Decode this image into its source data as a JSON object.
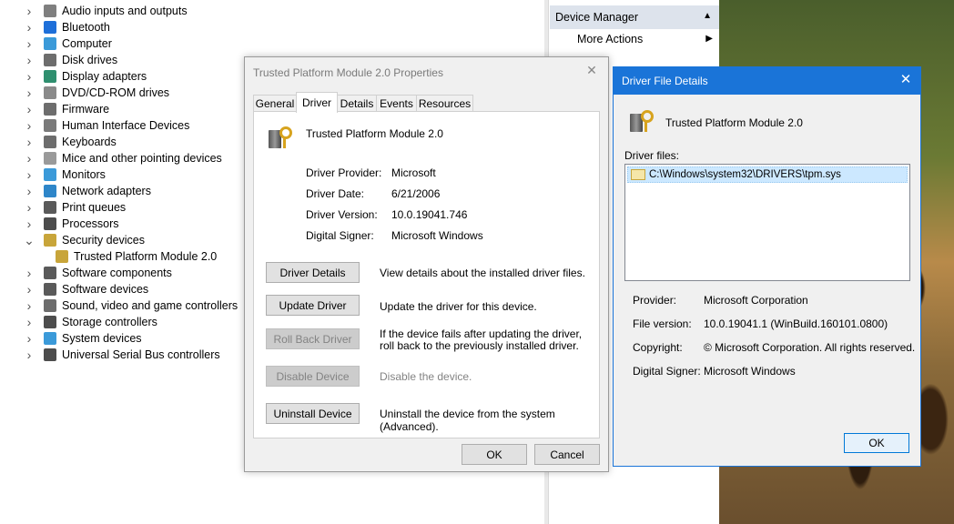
{
  "device_tree": {
    "items": [
      {
        "label": "Audio inputs and outputs",
        "icon": "speaker-icon",
        "color": "#7f7f7f",
        "expanded": false
      },
      {
        "label": "Bluetooth",
        "icon": "bluetooth-icon",
        "color": "#1e6fd9",
        "expanded": false
      },
      {
        "label": "Computer",
        "icon": "computer-icon",
        "color": "#3b9ad9",
        "expanded": false
      },
      {
        "label": "Disk drives",
        "icon": "disk-drive-icon",
        "color": "#6d6d6d",
        "expanded": false
      },
      {
        "label": "Display adapters",
        "icon": "display-adapter-icon",
        "color": "#2f8f6f",
        "expanded": false
      },
      {
        "label": "DVD/CD-ROM drives",
        "icon": "dvd-icon",
        "color": "#8a8a8a",
        "expanded": false
      },
      {
        "label": "Firmware",
        "icon": "firmware-icon",
        "color": "#6d6d6d",
        "expanded": false
      },
      {
        "label": "Human Interface Devices",
        "icon": "hid-icon",
        "color": "#7a7a7a",
        "expanded": false
      },
      {
        "label": "Keyboards",
        "icon": "keyboard-icon",
        "color": "#6d6d6d",
        "expanded": false
      },
      {
        "label": "Mice and other pointing devices",
        "icon": "mouse-icon",
        "color": "#9a9a9a",
        "expanded": false
      },
      {
        "label": "Monitors",
        "icon": "monitor-icon",
        "color": "#3b9ad9",
        "expanded": false
      },
      {
        "label": "Network adapters",
        "icon": "network-icon",
        "color": "#2e86c9",
        "expanded": false
      },
      {
        "label": "Print queues",
        "icon": "printer-icon",
        "color": "#5a5a5a",
        "expanded": false
      },
      {
        "label": "Processors",
        "icon": "processor-icon",
        "color": "#4d4d4d",
        "expanded": false
      },
      {
        "label": "Security devices",
        "icon": "security-device-icon",
        "color": "#c8a53a",
        "expanded": true
      },
      {
        "label": "Trusted Platform Module 2.0",
        "icon": "tpm-icon",
        "color": "#c8a53a",
        "child": true
      },
      {
        "label": "Software components",
        "icon": "software-component-icon",
        "color": "#5a5a5a",
        "expanded": false
      },
      {
        "label": "Software devices",
        "icon": "software-device-icon",
        "color": "#5a5a5a",
        "expanded": false
      },
      {
        "label": "Sound, video and game controllers",
        "icon": "sound-icon",
        "color": "#6d6d6d",
        "expanded": false
      },
      {
        "label": "Storage controllers",
        "icon": "storage-controller-icon",
        "color": "#4d4d4d",
        "expanded": false
      },
      {
        "label": "System devices",
        "icon": "system-device-icon",
        "color": "#3b9ad9",
        "expanded": false
      },
      {
        "label": "Universal Serial Bus controllers",
        "icon": "usb-icon",
        "color": "#4d4d4d",
        "expanded": false
      }
    ]
  },
  "actions_pane": {
    "header": "Device Manager",
    "more_actions": "More Actions"
  },
  "properties_dialog": {
    "title": "Trusted Platform Module 2.0 Properties",
    "tabs": [
      "General",
      "Driver",
      "Details",
      "Events",
      "Resources"
    ],
    "active_tab": "Driver",
    "device_name": "Trusted Platform Module 2.0",
    "info": {
      "provider_label": "Driver Provider:",
      "provider": "Microsoft",
      "date_label": "Driver Date:",
      "date": "6/21/2006",
      "version_label": "Driver Version:",
      "version": "10.0.19041.746",
      "signer_label": "Digital Signer:",
      "signer": "Microsoft Windows"
    },
    "buttons": {
      "driver_details": "Driver Details",
      "update_driver": "Update Driver",
      "roll_back": "Roll Back Driver",
      "disable": "Disable Device",
      "uninstall": "Uninstall Device"
    },
    "descriptions": {
      "driver_details": "View details about the installed driver files.",
      "update_driver": "Update the driver for this device.",
      "roll_back": "If the device fails after updating the driver, roll back to the previously installed driver.",
      "disable": "Disable the device.",
      "uninstall": "Uninstall the device from the system (Advanced)."
    },
    "ok": "OK",
    "cancel": "Cancel"
  },
  "driver_file_details": {
    "title": "Driver File Details",
    "device_name": "Trusted Platform Module 2.0",
    "files_label": "Driver files:",
    "files": [
      "C:\\Windows\\system32\\DRIVERS\\tpm.sys"
    ],
    "provider_label": "Provider:",
    "provider": "Microsoft Corporation",
    "version_label": "File version:",
    "version": "10.0.19041.1 (WinBuild.160101.0800)",
    "copyright_label": "Copyright:",
    "copyright": "© Microsoft Corporation. All rights reserved.",
    "signer_label": "Digital Signer:",
    "signer": "Microsoft Windows",
    "ok": "OK"
  },
  "colors": {
    "accent": "#1a74d8",
    "selection": "#cce8ff",
    "actions_header": "#dde3ec"
  }
}
